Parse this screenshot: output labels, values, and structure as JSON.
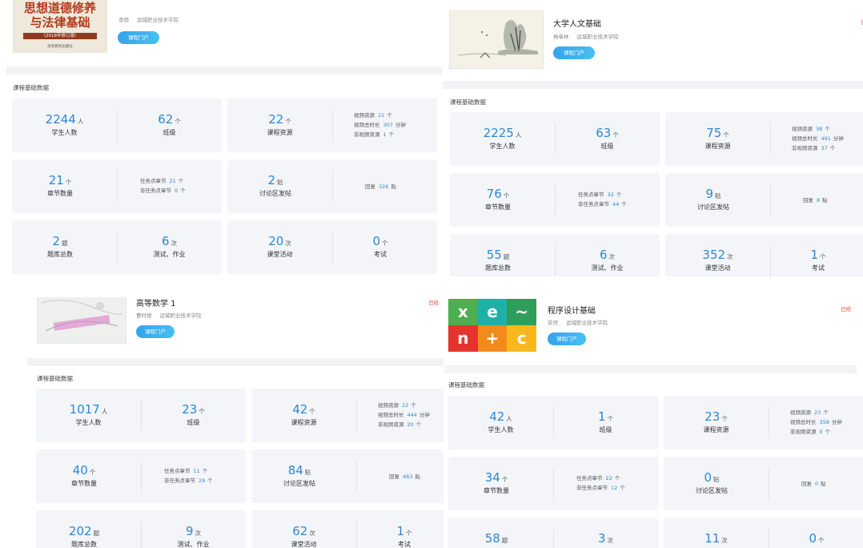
{
  "common": {
    "section_title": "课程基础数据",
    "portal_label": "课程门户",
    "labels": {
      "students": "学生人数",
      "classes": "班级",
      "resources": "课程资源",
      "chapters": "章节数量",
      "discussion": "讨论区发帖",
      "bank": "题库总数",
      "tests": "测试、作业",
      "activities": "课堂活动",
      "exam": "考试"
    },
    "detail_labels": {
      "video": "视频资源",
      "video_dur": "视频总时长",
      "nonvideo": "非视频资源",
      "task_ch": "任务点章节",
      "nontask_ch": "非任务点章节",
      "reply": "回复"
    },
    "units": {
      "person": "人",
      "ge": "个",
      "tie": "贴",
      "ti": "题",
      "ci": "次",
      "minute": "分钟"
    },
    "status_label": "已结"
  },
  "courses": [
    {
      "title": "",
      "cover_text_1": "思想道德修养",
      "cover_text_2": "与法律基础",
      "cover_text_3": "（2018年修订版）",
      "cover_text_4": "高等教育出版社",
      "teacher": "李德",
      "school": "运城职业技术学院",
      "stats": {
        "students": "2244",
        "classes": "62",
        "resources": "22",
        "video": "21",
        "video_dur": "307",
        "nonvideo": "1",
        "chapters": "21",
        "task_ch": "21",
        "nontask_ch": "0",
        "discussion": "2",
        "reply": "326",
        "bank": "2",
        "tests": "6",
        "activities": "20",
        "exam": "0"
      }
    },
    {
      "title": "大学人文基础",
      "teacher": "杨章林",
      "school": "运城职业技术学院",
      "stats": {
        "students": "2225",
        "classes": "63",
        "resources": "75",
        "video": "38",
        "video_dur": "491",
        "nonvideo": "37",
        "chapters": "76",
        "task_ch": "32",
        "nontask_ch": "44",
        "discussion": "9",
        "reply": "8",
        "bank": "55",
        "tests": "6",
        "activities": "352",
        "exam": "1"
      }
    },
    {
      "title": "高等数学 1",
      "teacher": "曹时德",
      "school": "运城职业技术学院",
      "stats": {
        "students": "1017",
        "classes": "23",
        "resources": "42",
        "video": "22",
        "video_dur": "444",
        "nonvideo": "20",
        "chapters": "40",
        "task_ch": "11",
        "nontask_ch": "29",
        "discussion": "84",
        "reply": "463",
        "bank": "202",
        "tests": "9",
        "activities": "62",
        "exam": "1"
      }
    },
    {
      "title": "程序设计基础",
      "teacher": "安然",
      "school": "运城职业技术学院",
      "stats": {
        "students": "42",
        "classes": "1",
        "resources": "23",
        "video": "23",
        "video_dur": "358",
        "nonvideo": "0",
        "chapters": "34",
        "task_ch": "22",
        "nontask_ch": "12",
        "discussion": "0",
        "reply": "0",
        "bank": "58",
        "tests": "3",
        "activities": "11",
        "exam": "0"
      }
    }
  ]
}
